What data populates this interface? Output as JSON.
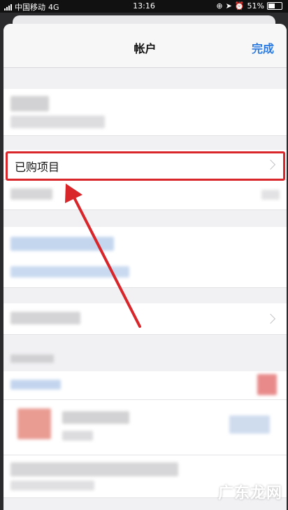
{
  "status_bar": {
    "carrier": "中国移动",
    "network": "4G",
    "time": "13:16",
    "battery": "51%"
  },
  "navbar": {
    "title": "帐户",
    "done_label": "完成"
  },
  "list": {
    "purchased_label": "已购项目"
  },
  "watermark": "广东龙网",
  "colors": {
    "accent": "#2a7ae2",
    "annotation": "#d9262b"
  }
}
